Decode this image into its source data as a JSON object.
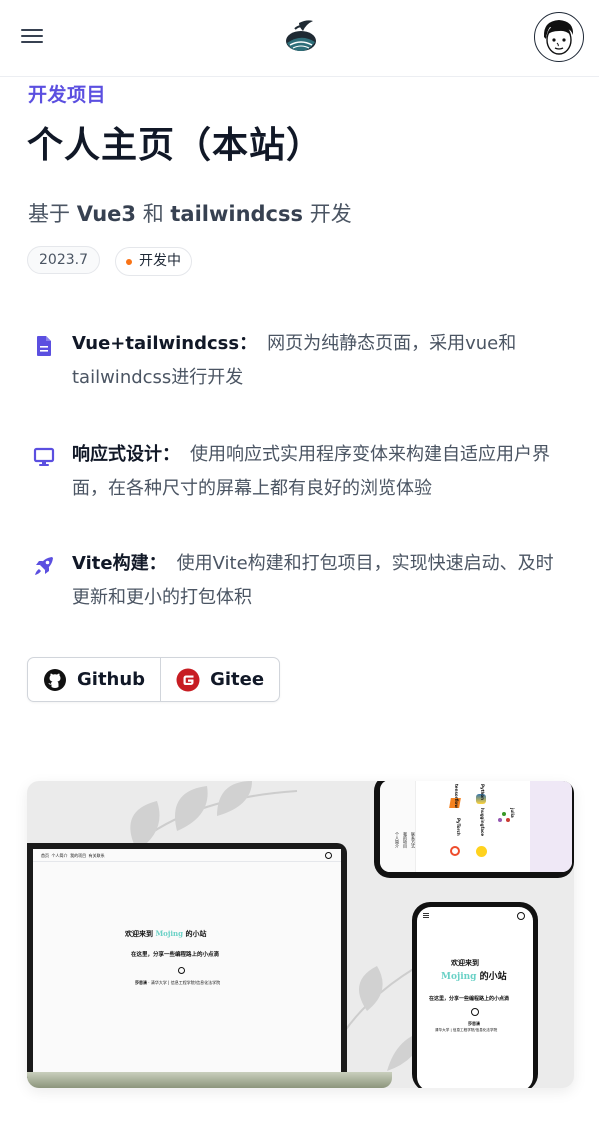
{
  "header": {
    "menu_icon": "hamburger-menu-icon",
    "logo_icon": "ink-logo-icon",
    "avatar_icon": "cartoon-avatar-icon"
  },
  "project": {
    "category": "开发项目",
    "title": "个人主页（本站）",
    "subtitle_prefix": "基于",
    "subtitle_tech1": "Vue3",
    "subtitle_and": "和",
    "subtitle_tech2": "tailwindcss",
    "subtitle_suffix": "开发",
    "date": "2023.7",
    "status": "开发中",
    "status_color": "#f97316",
    "accent_color": "#5b4fe0"
  },
  "features": [
    {
      "icon": "document-icon",
      "title": "Vue+tailwindcss：",
      "desc": "网页为纯静态页面，采用vue和tailwindcss进行开发"
    },
    {
      "icon": "monitor-icon",
      "title": "响应式设计：",
      "desc": "使用响应式实用程序变体来构建自适应用户界面，在各种尺寸的屏幕上都有良好的浏览体验"
    },
    {
      "icon": "rocket-icon",
      "title": "Vite构建：",
      "desc": "使用Vite构建和打包项目，实现快速启动、及时更新和更小的打包体积"
    }
  ],
  "links": [
    {
      "label": "Github",
      "icon": "github-icon"
    },
    {
      "label": "Gitee",
      "icon": "gitee-icon",
      "color": "#c71d23"
    }
  ],
  "preview": {
    "laptop_nav": [
      "首页",
      "个人简介",
      "我的项目",
      "有关联系"
    ],
    "welcome_prefix": "欢迎来到",
    "welcome_brand": "Mojing",
    "welcome_suffix": "的小站",
    "tagline": "在这里，分享一些编程路上的小点滴",
    "author": "莎思清",
    "school": "清华大学 | 信息工程学院/信息化法学院",
    "phone_tags": [
      "tensorflow",
      "PyTorch",
      "Python",
      "huggingface",
      "julia"
    ],
    "phone_side": [
      "个人简介",
      "我的项目",
      "联系方式"
    ]
  }
}
